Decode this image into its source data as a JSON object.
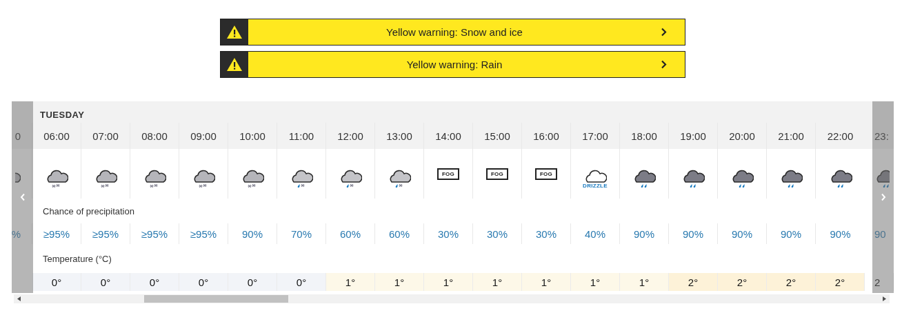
{
  "warnings": [
    {
      "text": "Yellow warning: Snow and ice"
    },
    {
      "text": "Yellow warning: Rain"
    }
  ],
  "forecast": {
    "day": "TUESDAY",
    "precip_label": "Chance of precipitation",
    "temp_label": "Temperature (°C)",
    "hours": [
      {
        "time": "0",
        "kind": "snow",
        "precip": "%"
      },
      {
        "time": "06:00",
        "kind": "snow",
        "precip": "≥95%",
        "temp": "0°",
        "color": "#f2f4f8"
      },
      {
        "time": "07:00",
        "kind": "snow",
        "precip": "≥95%",
        "temp": "0°",
        "color": "#f2f4f8"
      },
      {
        "time": "08:00",
        "kind": "snow",
        "precip": "≥95%",
        "temp": "0°",
        "color": "#f2f4f8"
      },
      {
        "time": "09:00",
        "kind": "snow",
        "precip": "≥95%",
        "temp": "0°",
        "color": "#f2f4f8"
      },
      {
        "time": "10:00",
        "kind": "snow",
        "precip": "90%",
        "temp": "0°",
        "color": "#f2f4f8"
      },
      {
        "time": "11:00",
        "kind": "sleet",
        "precip": "70%",
        "temp": "0°",
        "color": "#f2f4f8"
      },
      {
        "time": "12:00",
        "kind": "sleet",
        "precip": "60%",
        "temp": "1°",
        "color": "#fdf8e8"
      },
      {
        "time": "13:00",
        "kind": "sleet",
        "precip": "60%",
        "temp": "1°",
        "color": "#fdf8e8"
      },
      {
        "time": "14:00",
        "kind": "fog",
        "icon_label": "FOG",
        "precip": "30%",
        "temp": "1°",
        "color": "#fdf8e8"
      },
      {
        "time": "15:00",
        "kind": "fog",
        "icon_label": "FOG",
        "precip": "30%",
        "temp": "1°",
        "color": "#fdf8e8"
      },
      {
        "time": "16:00",
        "kind": "fog",
        "icon_label": "FOG",
        "precip": "30%",
        "temp": "1°",
        "color": "#fdf8e8"
      },
      {
        "time": "17:00",
        "kind": "drizzle",
        "icon_label": "DRIZZLE",
        "precip": "40%",
        "temp": "1°",
        "color": "#fdf8e8"
      },
      {
        "time": "18:00",
        "kind": "rain",
        "precip": "90%",
        "temp": "1°",
        "color": "#fdf8e8"
      },
      {
        "time": "19:00",
        "kind": "rain",
        "precip": "90%",
        "temp": "2°",
        "color": "#fdf2d8"
      },
      {
        "time": "20:00",
        "kind": "rain",
        "precip": "90%",
        "temp": "2°",
        "color": "#fdf2d8"
      },
      {
        "time": "21:00",
        "kind": "rain",
        "precip": "90%",
        "temp": "2°",
        "color": "#fdf2d8"
      },
      {
        "time": "22:00",
        "kind": "rain",
        "precip": "90%",
        "temp": "2°",
        "color": "#fdf2d8"
      },
      {
        "time": "23:",
        "kind": "rain",
        "precip": "90",
        "temp": "2"
      }
    ]
  }
}
